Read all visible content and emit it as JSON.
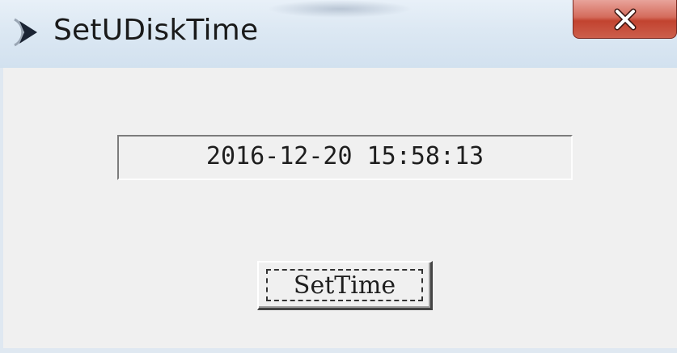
{
  "window": {
    "title": "SetUDiskTime",
    "title_icon": "app-arrow-icon",
    "close_icon": "close-x-icon"
  },
  "time_display": {
    "value": "2016-12-20  15:58:13"
  },
  "set_time_button": {
    "label": "SetTime"
  },
  "colors": {
    "titlebar": "#dce8f3",
    "close_button": "#c2432f",
    "client_background": "#f0f0f0"
  }
}
